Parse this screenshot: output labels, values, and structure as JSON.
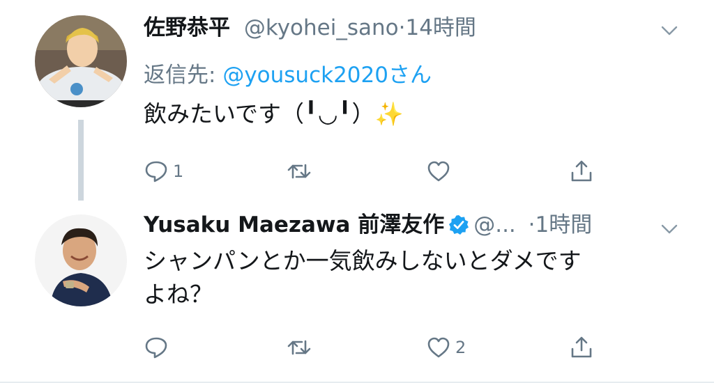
{
  "tweets": [
    {
      "name": "佐野恭平",
      "handle": "@kyohei_sano",
      "separator": "·",
      "time": "14時間",
      "reply_prefix": "返信先: ",
      "reply_mention": "@yousuck2020さん",
      "text": "飲みたいです（╹◡╹）✨",
      "reply_count": "1",
      "retweet_count": "",
      "like_count": ""
    },
    {
      "name": "Yusaku Maezawa 前澤友作",
      "handle": "@...",
      "separator": "·",
      "time": "1時間",
      "text_line1": "シャンパンとか一気飲みしないとダメです",
      "text_line2": "よね？",
      "reply_count": "",
      "retweet_count": "",
      "like_count": "2"
    }
  ],
  "colors": {
    "text": "#14171a",
    "secondary": "#657786",
    "link": "#1da1f2",
    "verified": "#1da1f2",
    "thread_line": "#cdd6dd"
  },
  "icons": [
    "reply-icon",
    "retweet-icon",
    "like-icon",
    "share-icon",
    "chevron-down-icon",
    "verified-badge-icon"
  ]
}
